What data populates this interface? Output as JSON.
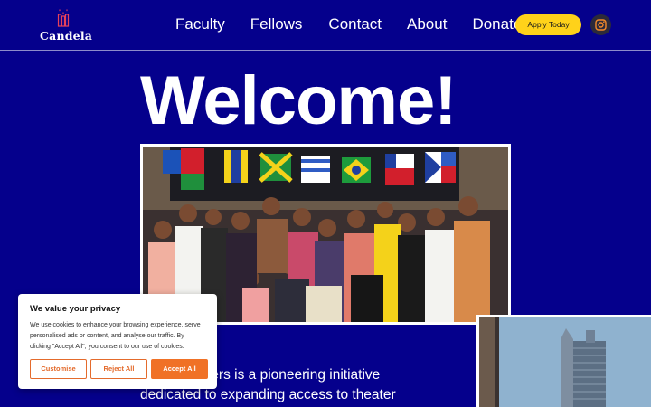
{
  "brand": {
    "name": "Candela"
  },
  "nav": {
    "items": [
      {
        "label": "Faculty"
      },
      {
        "label": "Fellows"
      },
      {
        "label": "Contact"
      },
      {
        "label": "About"
      },
      {
        "label": "Donate"
      }
    ],
    "apply_label": "Apply Today",
    "instagram_icon": "instagram-icon"
  },
  "hero": {
    "heading": "Welcome!",
    "body_visible": "ters is a pioneering initiative",
    "body_line2": "dedicated to expanding access to theater"
  },
  "cookie": {
    "title": "We value your privacy",
    "text": "We use cookies to enhance your browsing experience, serve personalised ads or content, and analyse our traffic. By clicking \"Accept All\", you consent to our use of cookies.",
    "customise_label": "Customise",
    "reject_label": "Reject All",
    "accept_label": "Accept All"
  },
  "colors": {
    "background": "#05008c",
    "apply_button": "#ffd21a",
    "accept_button": "#f07126"
  }
}
